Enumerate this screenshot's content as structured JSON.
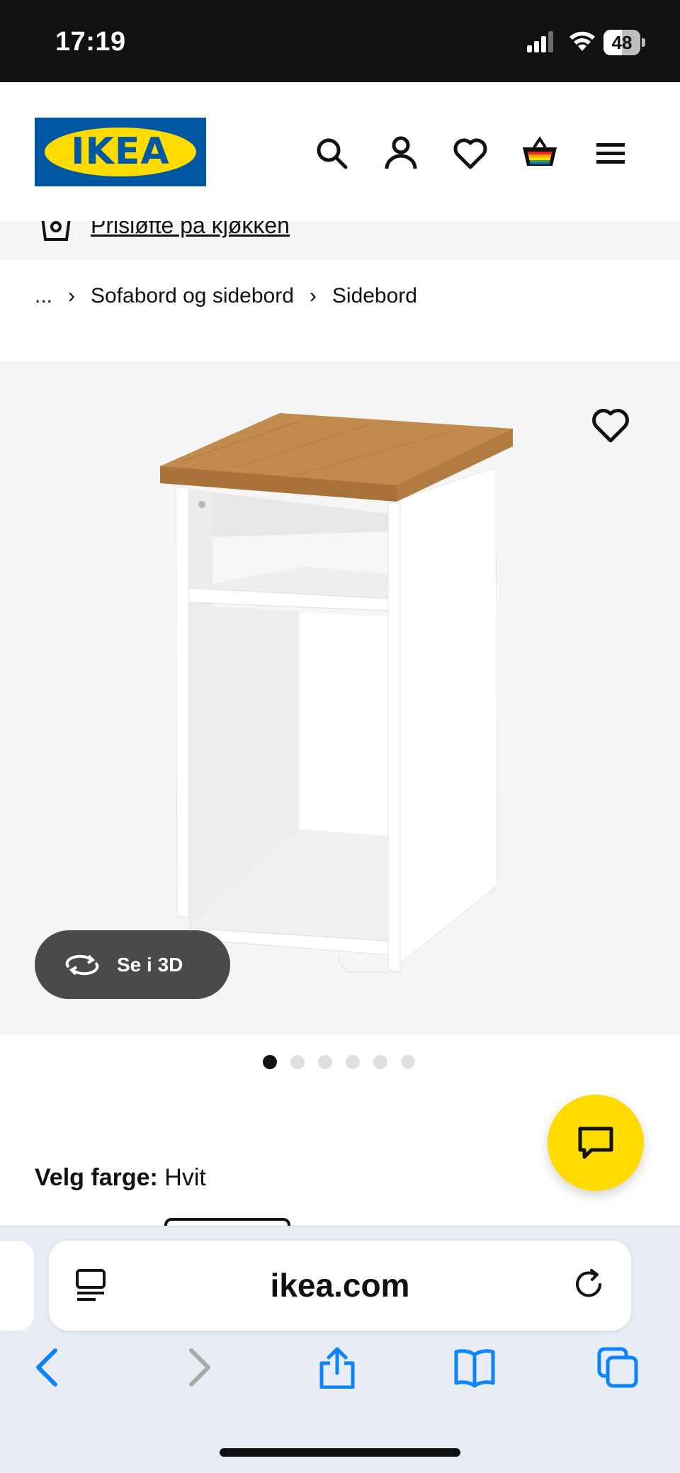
{
  "status_bar": {
    "time": "17:19",
    "battery": "48"
  },
  "header": {
    "logo_text": "IKEA",
    "icons": [
      "search-icon",
      "account-icon",
      "heart-icon",
      "basket-icon",
      "menu-icon"
    ]
  },
  "promo": {
    "text": "Prisløfte på kjøkken"
  },
  "breadcrumb": {
    "ellipsis": "...",
    "items": [
      "Sofabord og sidebord",
      "Sidebord"
    ]
  },
  "product": {
    "see_3d_label": "Se i 3D",
    "image_count": 6,
    "active_image": 1
  },
  "color_selector": {
    "label": "Velg farge:",
    "value": "Hvit"
  },
  "safari": {
    "url": "ikea.com"
  },
  "colors": {
    "ikea_blue": "#0058a3",
    "ikea_yellow": "#ffdb00",
    "safari_blue": "#0a84ff"
  }
}
